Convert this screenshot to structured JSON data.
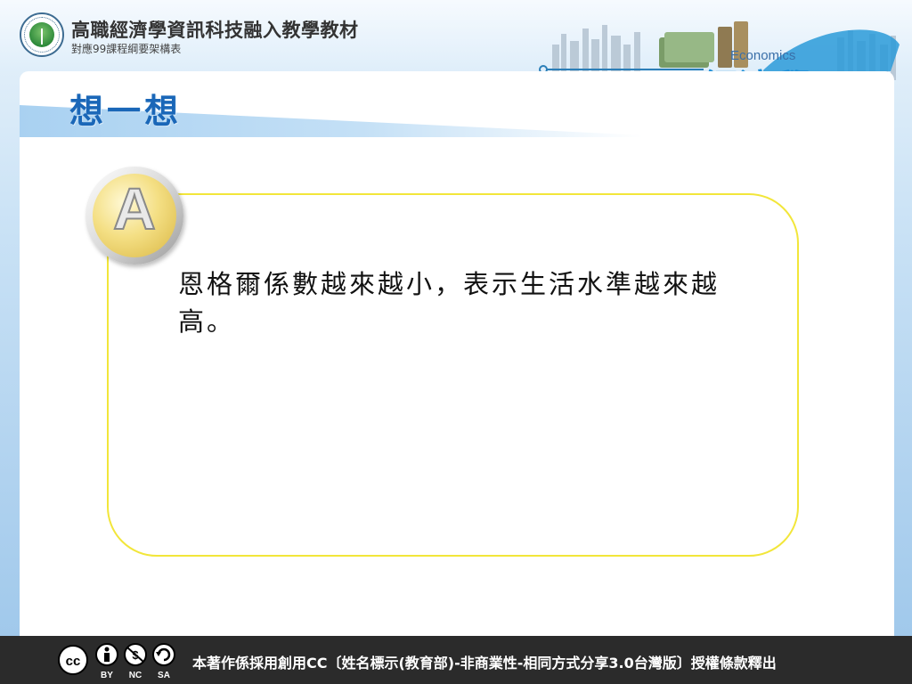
{
  "header": {
    "title": "高職經濟學資訊科技融入教學教材",
    "subtitle": "對應99課程綱要架構表",
    "seal_icon": "ministry-of-education-seal-icon",
    "logo_en": "Economics",
    "logo_zh": "經濟學"
  },
  "slide": {
    "title": "想一想",
    "badge_letter": "A",
    "answer_text": "恩格爾係數越來越小，表示生活水準越來越高。"
  },
  "footer": {
    "cc_icons": [
      "cc-icon",
      "by-icon",
      "nc-icon",
      "sa-icon"
    ],
    "cc_labels": {
      "by": "BY",
      "nc": "NC",
      "sa": "SA"
    },
    "license_text": "本著作係採用創用CC〔姓名標示(教育部)-非商業性-相同方式分享3.0台灣版〕授權條款釋出"
  },
  "colors": {
    "title_blue": "#1a67b8",
    "card_border": "#f2e63a",
    "footer_bg": "#2b2b2b"
  }
}
